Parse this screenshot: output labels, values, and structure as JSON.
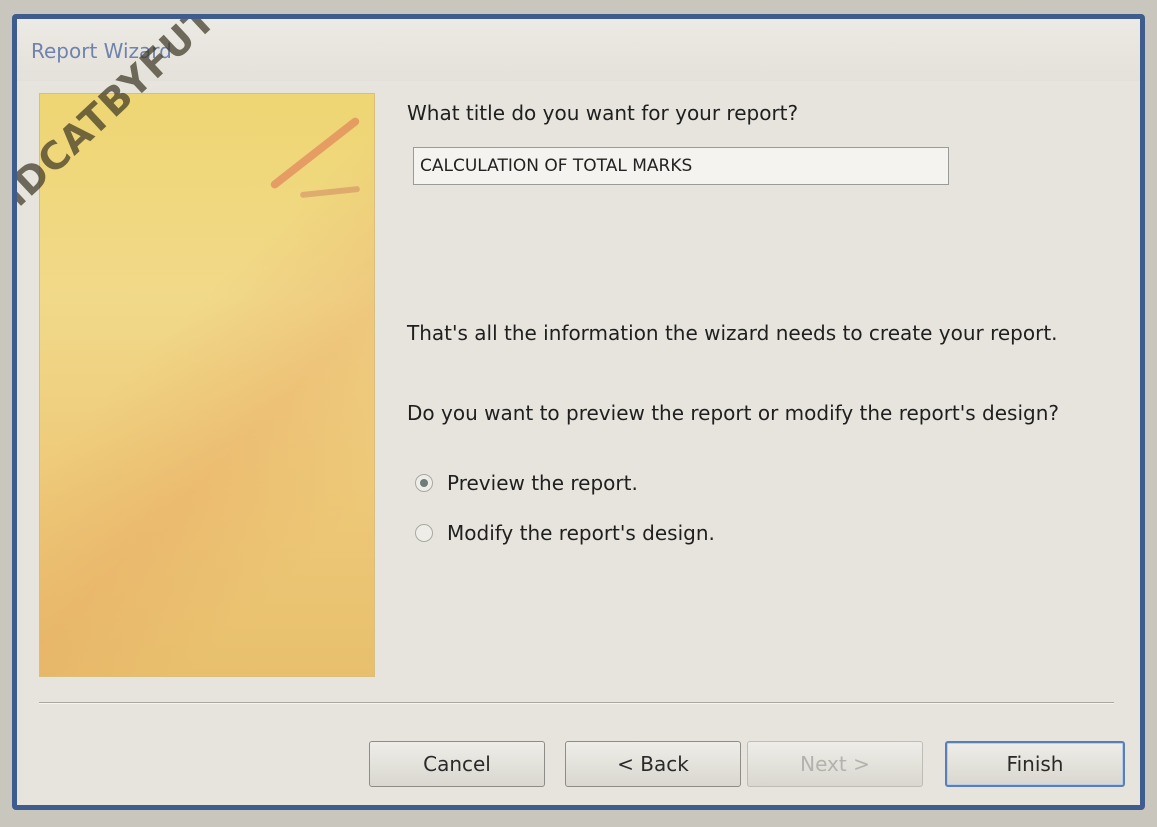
{
  "window": {
    "title": "Report Wizard"
  },
  "watermark": "MDCATBYFUTUREDOCTORS",
  "main": {
    "title_question": "What title do you want for your report?",
    "title_value": "CALCULATION OF TOTAL MARKS",
    "info": "That's all the information the wizard needs to create your report.",
    "preview_question": "Do you want to preview the report or modify the report's design?",
    "options": [
      {
        "label": "Preview the report.",
        "selected": true
      },
      {
        "label": "Modify the report's design.",
        "selected": false
      }
    ]
  },
  "buttons": {
    "cancel": "Cancel",
    "back": "< Back",
    "next": "Next >",
    "finish": "Finish"
  }
}
